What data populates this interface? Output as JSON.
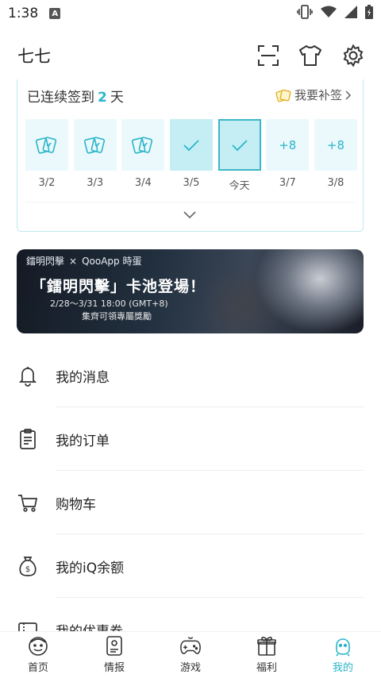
{
  "status_bar": {
    "time": "1:38",
    "app_badge": "A"
  },
  "header": {
    "username": "七七"
  },
  "checkin": {
    "title_prefix": "已连续签到",
    "days": "2",
    "title_suffix": "天",
    "makeup": "我要补签",
    "items": [
      {
        "date": "3/2",
        "state": "card"
      },
      {
        "date": "3/3",
        "state": "card"
      },
      {
        "date": "3/4",
        "state": "card"
      },
      {
        "date": "3/5",
        "state": "checked"
      },
      {
        "date": "今天",
        "state": "today"
      },
      {
        "date": "3/7",
        "reward": "+8"
      },
      {
        "date": "3/8",
        "reward": "+8"
      }
    ]
  },
  "banner": {
    "logo_left": "鐳明閃擊",
    "logo_x": "×",
    "logo_right": "QooApp 時蛋",
    "headline": "「鐳明閃擊」卡池登場！",
    "dates": "2/28～3/31 18:00 (GMT+8)",
    "sub": "集齊可領專屬獎勵"
  },
  "menu": [
    {
      "label": "我的消息",
      "icon": "bell-icon"
    },
    {
      "label": "我的订单",
      "icon": "clipboard-icon"
    },
    {
      "label": "购物车",
      "icon": "cart-icon"
    },
    {
      "label": "我的iQ余额",
      "icon": "money-bag-icon"
    },
    {
      "label": "我的优惠券",
      "icon": "coupon-icon"
    }
  ],
  "tabs": [
    {
      "label": "首页",
      "icon": "home-mascot-icon"
    },
    {
      "label": "情报",
      "icon": "news-icon"
    },
    {
      "label": "游戏",
      "icon": "gamepad-icon"
    },
    {
      "label": "福利",
      "icon": "gift-icon"
    },
    {
      "label": "我的",
      "icon": "profile-mascot-icon"
    }
  ],
  "colors": {
    "accent": "#2ab5c8",
    "card_bg": "#ebf9fc",
    "checked_bg": "#c5eef4"
  }
}
